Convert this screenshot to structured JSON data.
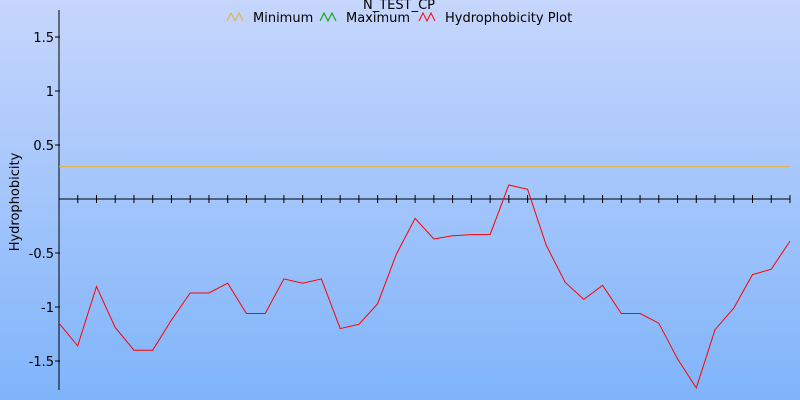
{
  "chart_data": {
    "type": "line",
    "title": "N_TEST_CP",
    "ylabel": "Hydrophobicity",
    "xlabel": "",
    "ylim": [
      -1.75,
      1.75
    ],
    "yticks": [
      1.5,
      1,
      0.5,
      -0.5,
      -1,
      -1.5
    ],
    "ytick_labels": [
      "1.5",
      "1",
      "0.5",
      "-0.5",
      "-1",
      "-1.5"
    ],
    "background": [
      "#c6d6fc",
      "#7fb4fa"
    ],
    "legend": [
      {
        "label": "Minimum",
        "color": "#e8b040"
      },
      {
        "label": "Maximum",
        "color": "#00a000"
      },
      {
        "label": "Hydrophobicity Plot",
        "color": "#ff0000"
      }
    ],
    "series": [
      {
        "name": "Minimum",
        "color": "#e8b040",
        "x": [
          1,
          40
        ],
        "values": [
          0.3,
          0.3
        ]
      },
      {
        "name": "Hydrophobicity Plot",
        "color": "#ff0000",
        "x": [
          1,
          2,
          3,
          4,
          5,
          6,
          7,
          8,
          9,
          10,
          11,
          12,
          13,
          14,
          15,
          16,
          17,
          18,
          19,
          20,
          21,
          22,
          23,
          24,
          25,
          26,
          27,
          28,
          29,
          30,
          31,
          32,
          33,
          34,
          35,
          36,
          37,
          38,
          39,
          40
        ],
        "values": [
          -1.15,
          -1.36,
          -0.81,
          -1.19,
          -1.4,
          -1.4,
          -1.12,
          -0.87,
          -0.87,
          -0.78,
          -1.06,
          -1.06,
          -0.74,
          -0.78,
          -0.74,
          -1.2,
          -1.16,
          -0.97,
          -0.51,
          -0.18,
          -0.37,
          -0.34,
          -0.33,
          -0.33,
          0.13,
          0.09,
          -0.43,
          -0.77,
          -0.93,
          -0.8,
          -1.06,
          -1.06,
          -1.15,
          -1.48,
          -1.75,
          -1.21,
          -1.01,
          -0.7,
          -0.65,
          -0.39
        ]
      }
    ]
  }
}
